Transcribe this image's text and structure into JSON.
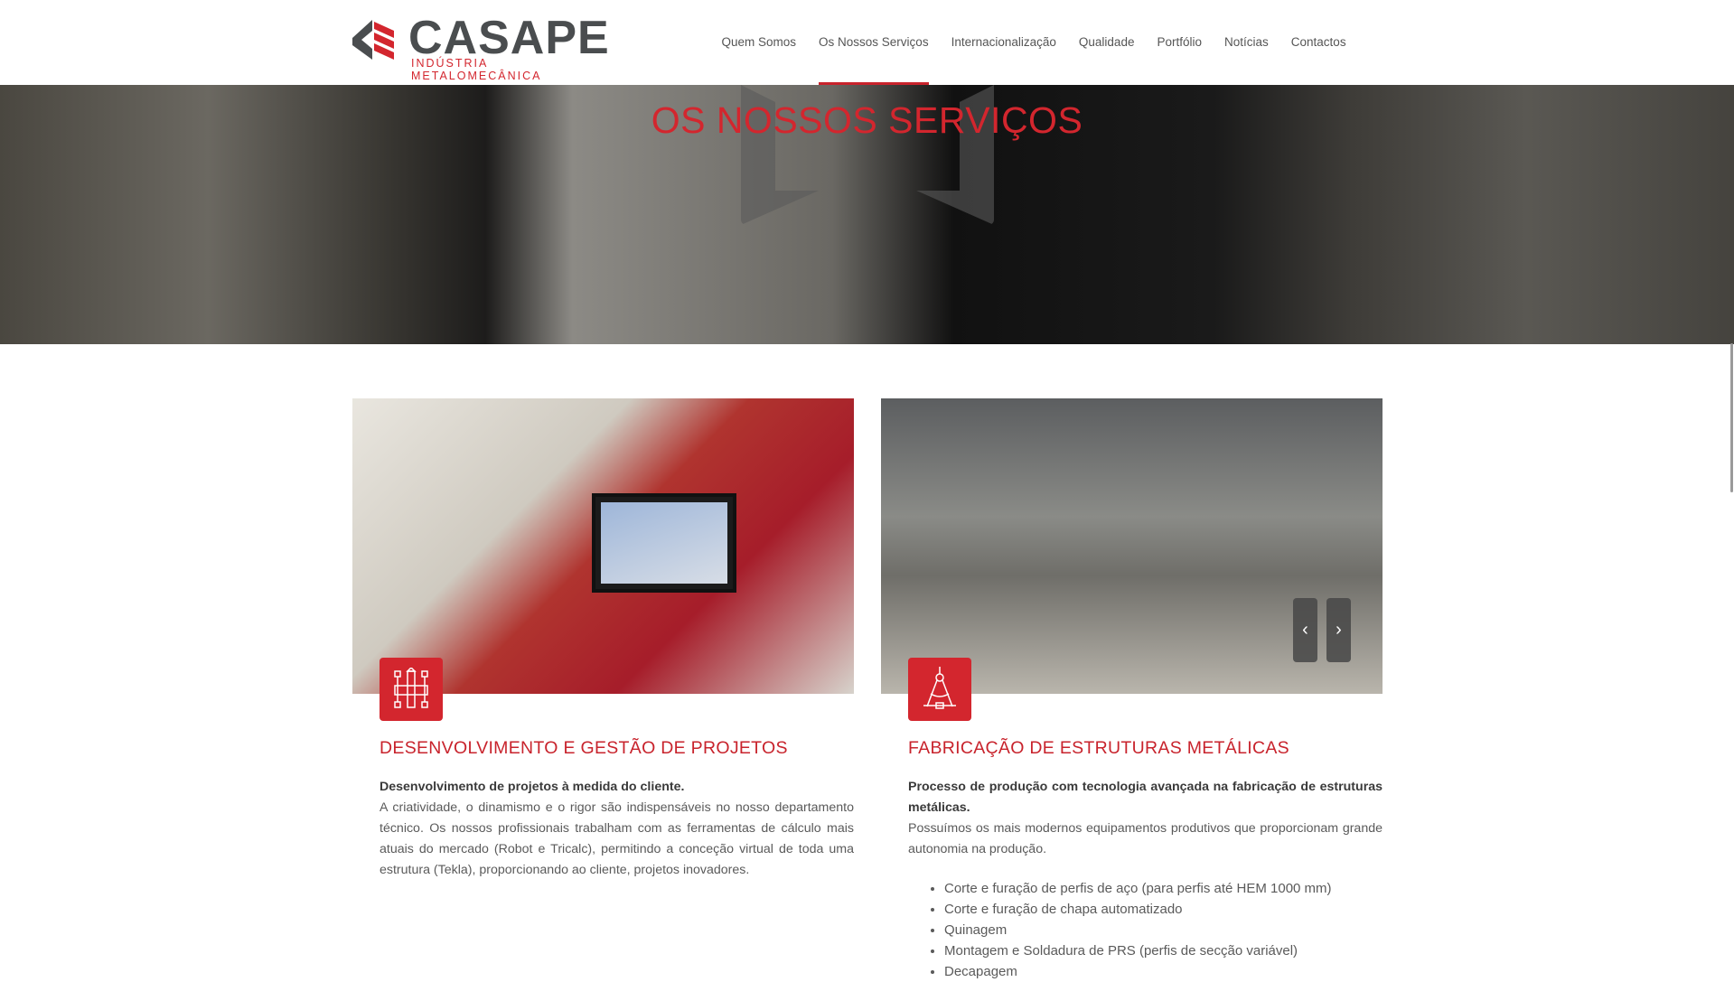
{
  "brand": {
    "name": "CASAPE",
    "tagline": "INDÚSTRIA METALOMECÂNICA",
    "accent": "#d3262e"
  },
  "nav": [
    {
      "label": "Quem Somos"
    },
    {
      "label": "Os Nossos Serviços",
      "active": true
    },
    {
      "label": "Internacionalização"
    },
    {
      "label": "Qualidade"
    },
    {
      "label": "Portfólio"
    },
    {
      "label": "Notícias"
    },
    {
      "label": "Contactos"
    }
  ],
  "hero": {
    "title": "OS NOSSOS SERVIÇOS"
  },
  "cards": [
    {
      "icon": "blueprint-icon",
      "title": "DESENVOLVIMENTO E GESTÃO DE PROJETOS",
      "lead": "Desenvolvimento de projetos à medida do cliente.",
      "text": "A criatividade, o dinamismo e o rigor são indispensáveis no nosso departamento técnico. Os nossos profissionais trabalham com as ferramentas de cálculo mais atuais do mercado (Robot e Tricalc), permitindo a conceção virtual de toda uma estrutura (Tekla), proporcionando ao cliente, projetos inovadores."
    },
    {
      "icon": "compass-icon",
      "title": "FABRICAÇÃO DE ESTRUTURAS METÁLICAS",
      "lead": "Processo de produção com tecnologia avançada na fabricação de estruturas metálicas.",
      "text": "Possuímos os mais modernos equipamentos produtivos que proporcionam grande autonomia na produção.",
      "list": [
        "Corte e furação de perfis de aço (para perfis até HEM 1000 mm)",
        "Corte e furação de chapa automatizado",
        "Quinagem",
        "Montagem e Soldadura de PRS (perfis de secção variável)",
        "Decapagem"
      ],
      "carousel": {
        "prev": "‹",
        "next": "›"
      }
    }
  ]
}
